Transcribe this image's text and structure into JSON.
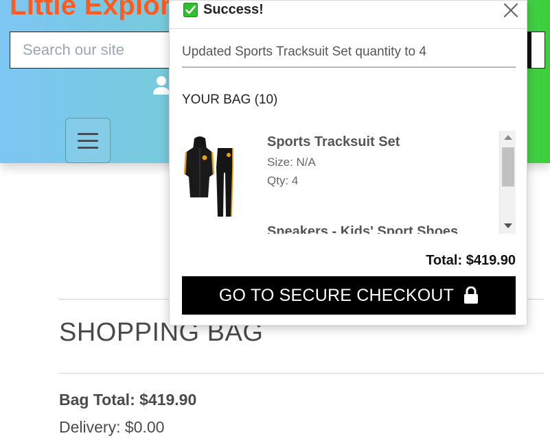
{
  "header": {
    "brand": "Little Explor",
    "search_placeholder": "Search our site",
    "icons": [
      "user-icon",
      "hamburger-icon",
      "search-icon"
    ],
    "brand_color": "#ff5a1f"
  },
  "toast": {
    "title": "Success!",
    "message": "Updated Sports Tracksuit Set quantity to 4",
    "bag_count": "YOUR BAG (10)",
    "items": [
      {
        "name": "Sports Tracksuit Set",
        "size": "Size: N/A",
        "qty": "Qty: 4"
      },
      {
        "name": "Sneakers - Kids' Sport Shoes"
      }
    ],
    "total": "Total: $419.90",
    "checkout_label": "GO TO SECURE CHECKOUT",
    "icons": [
      "check-icon",
      "close-icon",
      "lock-icon"
    ]
  },
  "page": {
    "heading": "SHOPPING BAG",
    "bag_total": "Bag Total: $419.90",
    "delivery": "Delivery: $0.00"
  },
  "colors": {
    "accent_orange": "#ff5a1f",
    "gradient_start": "#7cc6f3",
    "gradient_end": "#3ccf3a",
    "checkout_button": "#000000",
    "success_check": "#2fbf2f"
  }
}
